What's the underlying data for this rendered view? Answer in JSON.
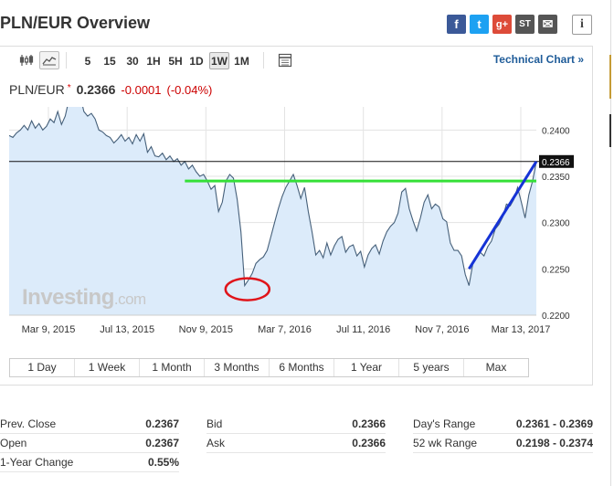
{
  "header": {
    "title": "PLN/EUR Overview",
    "share": {
      "facebook": "f",
      "twitter": "t",
      "google": "g+",
      "stocktwits": "ST",
      "mail": "✉"
    },
    "info": "i"
  },
  "toolbar": {
    "intervals": [
      "5",
      "15",
      "30",
      "1H",
      "5H",
      "1D",
      "1W",
      "1M"
    ],
    "selected": "1W",
    "technical_chart": "Technical Chart »"
  },
  "quote": {
    "symbol": "PLN/EUR",
    "star": "*",
    "last": "0.2366",
    "change": "-0.0001",
    "change_pct": "(-0.04%)"
  },
  "chart_data": {
    "type": "area",
    "x_ticks": [
      "Mar 9, 2015",
      "Jul 13, 2015",
      "Nov 9, 2015",
      "Mar 7, 2016",
      "Jul 11, 2016",
      "Nov 7, 2016",
      "Mar 13, 2017"
    ],
    "y_ticks": [
      "0.2400",
      "0.2350",
      "0.2300",
      "0.2250",
      "0.2200"
    ],
    "ylim": [
      0.22,
      0.2425
    ],
    "last_price_label": "0.2366",
    "last_price": 0.2366,
    "series": [
      {
        "values": [
          0.2394,
          0.2392,
          0.2397,
          0.24,
          0.2405,
          0.24,
          0.241,
          0.2402,
          0.2407,
          0.24,
          0.2404,
          0.2412,
          0.2408,
          0.242,
          0.2406,
          0.2415,
          0.2433,
          0.2438,
          0.2431,
          0.2437,
          0.242,
          0.2415,
          0.2418,
          0.2412,
          0.24,
          0.2398,
          0.2394,
          0.2392,
          0.2386,
          0.239,
          0.2395,
          0.2388,
          0.2392,
          0.2385,
          0.2395,
          0.2388,
          0.2396,
          0.2376,
          0.2382,
          0.2372,
          0.2371,
          0.2375,
          0.2368,
          0.2372,
          0.2366,
          0.2369,
          0.2362,
          0.2366,
          0.2358,
          0.2362,
          0.2355,
          0.235,
          0.2352,
          0.2345,
          0.2336,
          0.234,
          0.2312,
          0.2322,
          0.2345,
          0.2352,
          0.2348,
          0.2325,
          0.229,
          0.2232,
          0.2238,
          0.2245,
          0.2256,
          0.226,
          0.2263,
          0.227,
          0.2285,
          0.23,
          0.2315,
          0.2328,
          0.2338,
          0.2345,
          0.2352,
          0.234,
          0.2326,
          0.2338,
          0.2312,
          0.229,
          0.2265,
          0.227,
          0.2262,
          0.2278,
          0.2265,
          0.2275,
          0.2282,
          0.2285,
          0.2268,
          0.2274,
          0.2276,
          0.2264,
          0.2269,
          0.2252,
          0.2265,
          0.2272,
          0.2276,
          0.2266,
          0.228,
          0.229,
          0.2296,
          0.23,
          0.231,
          0.2333,
          0.2337,
          0.2315,
          0.2302,
          0.2291,
          0.2305,
          0.2322,
          0.233,
          0.2315,
          0.232,
          0.2317,
          0.2304,
          0.2301,
          0.2278,
          0.227,
          0.227,
          0.2264,
          0.2244,
          0.2232,
          0.2255,
          0.2262,
          0.2268,
          0.2264,
          0.2274,
          0.228,
          0.2293,
          0.2298,
          0.2306,
          0.232,
          0.2318,
          0.2325,
          0.2338,
          0.2322,
          0.2305,
          0.233,
          0.2345,
          0.2366
        ]
      }
    ],
    "annotations": {
      "horizontal_line": 0.2366,
      "support_line": 0.2345,
      "trend_line": [
        0.225,
        0.2366
      ],
      "circle_low": 0.2232
    },
    "colors": {
      "line": "#46607a",
      "fill": "#dcebfa",
      "green": "#35e038",
      "blue": "#1533d6",
      "red": "#e0141a"
    },
    "grid": true
  },
  "watermark": {
    "brand": "Investing",
    "suffix": ".com"
  },
  "ranges": [
    "1 Day",
    "1 Week",
    "1 Month",
    "3 Months",
    "6 Months",
    "1 Year",
    "5 years",
    "Max"
  ],
  "stats": {
    "col1": [
      {
        "label": "Prev. Close",
        "value": "0.2367"
      },
      {
        "label": "Open",
        "value": "0.2367"
      },
      {
        "label": "1-Year Change",
        "value": "0.55%"
      }
    ],
    "col2": [
      {
        "label": "Bid",
        "value": "0.2366"
      },
      {
        "label": "Ask",
        "value": "0.2366"
      }
    ],
    "col3": [
      {
        "label": "Day's Range",
        "value": "0.2361 - 0.2369"
      },
      {
        "label": "52 wk Range",
        "value": "0.2198 - 0.2374"
      }
    ]
  }
}
